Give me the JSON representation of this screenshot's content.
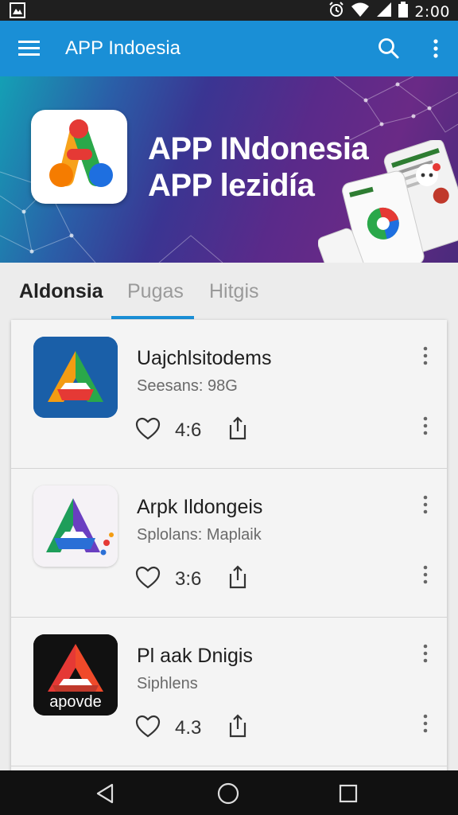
{
  "status_bar": {
    "time": "2:00",
    "icons": [
      "gallery-icon",
      "alarm-icon",
      "wifi-icon",
      "signal-icon",
      "battery-icon"
    ]
  },
  "app_bar": {
    "title": "APP Indoesia",
    "icons": [
      "menu-icon",
      "search-icon",
      "more-vert-icon"
    ]
  },
  "banner": {
    "line1": "APP INdonesia",
    "line2": "APP lezidía"
  },
  "tabs": [
    {
      "label": "Aldonsia",
      "active": true
    },
    {
      "label": "Pugas",
      "active": false
    },
    {
      "label": "Hitgis",
      "active": false
    }
  ],
  "apps": [
    {
      "name": "Uajchlsitodems",
      "subtitle": "Seesans: 98G",
      "rating": "4:6",
      "icon_bg": "#1a5fa8"
    },
    {
      "name": "Arpk Ildongeis",
      "subtitle": "Splolans: Maplaik",
      "rating": "3:6",
      "icon_bg": "#f7f7f7"
    },
    {
      "name": "Pl aak Dnigis",
      "subtitle": "Siphlens",
      "rating": "4.3",
      "icon_bg": "#111111",
      "icon_text": "apovde"
    }
  ],
  "nav_bar": {
    "icons": [
      "back-icon",
      "home-icon",
      "recents-icon"
    ]
  },
  "colors": {
    "accent": "#1a8fd6",
    "status_bar": "#1f1f1f",
    "nav_bar": "#111111"
  }
}
